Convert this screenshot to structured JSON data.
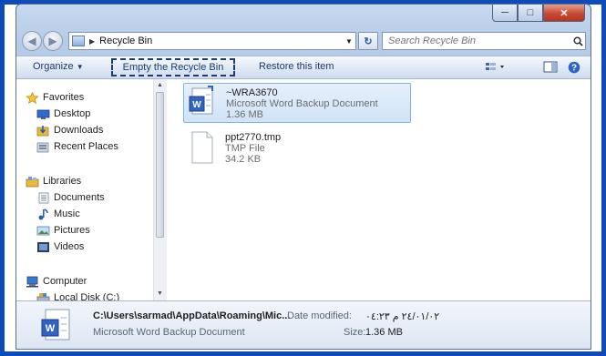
{
  "window": {
    "address_path": "Recycle Bin",
    "search_placeholder": "Search Recycle Bin"
  },
  "toolbar": {
    "organize_label": "Organize",
    "empty_label": "Empty the Recycle Bin",
    "restore_label": "Restore this item"
  },
  "nav": {
    "favorites": {
      "label": "Favorites",
      "items": [
        {
          "label": "Desktop",
          "icon": "desktop-icon"
        },
        {
          "label": "Downloads",
          "icon": "downloads-icon"
        },
        {
          "label": "Recent Places",
          "icon": "recent-places-icon"
        }
      ]
    },
    "libraries": {
      "label": "Libraries",
      "items": [
        {
          "label": "Documents",
          "icon": "documents-icon"
        },
        {
          "label": "Music",
          "icon": "music-icon"
        },
        {
          "label": "Pictures",
          "icon": "pictures-icon"
        },
        {
          "label": "Videos",
          "icon": "videos-icon"
        }
      ]
    },
    "computer": {
      "label": "Computer",
      "items": [
        {
          "label": "Local Disk (C:)",
          "icon": "local-disk-icon"
        }
      ]
    }
  },
  "files": [
    {
      "name": "~WRA3670",
      "type": "Microsoft Word Backup Document",
      "size": "1.36 MB",
      "selected": true
    },
    {
      "name": "ppt2770.tmp",
      "type": "TMP File",
      "size": "34.2 KB",
      "selected": false
    }
  ],
  "details": {
    "path": "C:\\Users\\sarmad\\AppData\\Roaming\\Mic...",
    "type": "Microsoft Word Backup Document",
    "modified_label": "Date modified:",
    "modified_value": "٢٤/٠١/٠٢ م ٠٤:٢٣",
    "size_label": "Size:",
    "size_value": "1.36 MB"
  },
  "colors": {
    "frame_border": "#0e4ab8",
    "selection": "#d0e3f8",
    "toolbar_text": "#1e3a66"
  }
}
